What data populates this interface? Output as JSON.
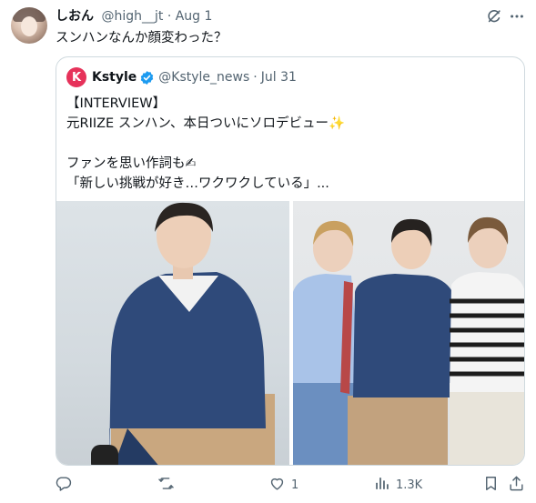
{
  "tweet": {
    "display_name": "しおん",
    "handle": "@high__jt",
    "separator": "·",
    "date": "Aug 1",
    "text": "スンハンなんか顔変わった？"
  },
  "quote": {
    "avatar_letter": "K",
    "display_name": "Kstyle",
    "handle": "@Kstyle_news",
    "separator": "·",
    "date": "Jul 31",
    "lines": [
      "【INTERVIEW】",
      "元RIIZE スンハン、本日ついにソロデビュー✨",
      "",
      "ファンを思い作詞も✍",
      "「新しい挑戦が好き…ワクワクしている」..."
    ],
    "images": [
      "photo-solo",
      "photo-group"
    ]
  },
  "actions": {
    "reply_count": "",
    "retweet_count": "",
    "like_count": "1",
    "views_count": "1.3K"
  },
  "colors": {
    "text_primary": "#0f1419",
    "text_secondary": "#536471",
    "border": "#cfd9de",
    "verified": "#1d9bf0",
    "kstyle_brand": "#e6325a"
  },
  "icons": [
    "grok-icon",
    "more-icon",
    "verified-icon",
    "reply-icon",
    "retweet-icon",
    "like-icon",
    "views-icon",
    "bookmark-icon",
    "share-icon"
  ]
}
